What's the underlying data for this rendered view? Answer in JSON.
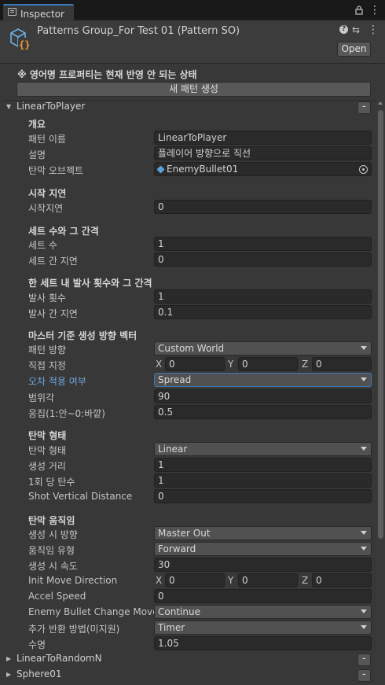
{
  "tab": {
    "label": "Inspector"
  },
  "header": {
    "title": "Patterns Group_For Test 01 (Pattern SO)",
    "help_icon": "?",
    "settings_icon": "⇆",
    "menu_icon": "⋮",
    "open_label": "Open"
  },
  "notice": "※ 영어명 프로퍼티는 현재 반영 안 되는 상태",
  "new_pattern_button": "새 패턴 생성",
  "patterns": [
    {
      "name": "LinearToPlayer",
      "expanded": true,
      "remove_label": "-"
    },
    {
      "name": "LinearToRandomN",
      "expanded": false,
      "remove_label": "-"
    },
    {
      "name": "Sphere01",
      "expanded": false,
      "remove_label": "-"
    }
  ],
  "fields": {
    "overview": {
      "header": "개요",
      "name_label": "패턴 이름",
      "name_value": "LinearToPlayer",
      "desc_label": "설명",
      "desc_value": "플레이어 방향으로 직선",
      "bullet_label": "탄막 오브젝트",
      "bullet_value": "EnemyBullet01"
    },
    "start_delay": {
      "header": "시작 지연",
      "label": "시작지연",
      "value": "0"
    },
    "sets": {
      "header": "세트 수와 그 간격",
      "count_label": "세트 수",
      "count_value": "1",
      "delay_label": "세트 간 지연",
      "delay_value": "0"
    },
    "fire": {
      "header": "한 세트 내 발사 횟수와 그 간격",
      "count_label": "발사 횟수",
      "count_value": "1",
      "delay_label": "발사 간 지연",
      "delay_value": "0.1"
    },
    "direction": {
      "header": "마스터 기준 생성 방향 벡터",
      "pattern_dir_label": "패턴 방향",
      "pattern_dir_value": "Custom World",
      "direct_label": "직접 지정",
      "x_label": "X",
      "x_value": "0",
      "y_label": "Y",
      "y_value": "0",
      "z_label": "Z",
      "z_value": "0",
      "error_label": "오차 적용 여부",
      "error_value": "Spread",
      "range_label": "범위각",
      "range_value": "90",
      "cohesion_label": "응집(1:안~0:바깥)",
      "cohesion_value": "0.5"
    },
    "shape": {
      "header": "탄막 형태",
      "shape_label": "탄막 형태",
      "shape_value": "Linear",
      "distance_label": "생성 거리",
      "distance_value": "1",
      "per_shot_label": "1회 당 탄수",
      "per_shot_value": "1",
      "vertical_label": "Shot Vertical Distance",
      "vertical_value": "0"
    },
    "movement": {
      "header": "탄막 움직임",
      "spawn_dir_label": "생성 시 방향",
      "spawn_dir_value": "Master Out",
      "move_type_label": "움직임 유형",
      "move_type_value": "Forward",
      "speed_label": "생성 시 속도",
      "speed_value": "30",
      "init_dir_label": "Init Move Direction",
      "x_label": "X",
      "x_value": "0",
      "y_label": "Y",
      "y_value": "0",
      "z_label": "Z",
      "z_value": "0",
      "accel_label": "Accel Speed",
      "accel_value": "0",
      "change_label": "Enemy Bullet Change Move",
      "change_value": "Continue",
      "extra_label": "추가 반환 방법(미지원)",
      "extra_value": "Timer",
      "life_label": "수명",
      "life_value": "1.05"
    }
  },
  "colors": {
    "accent": "#3a79bb",
    "highlight_label": "#6fa4d8",
    "background": "#383838"
  }
}
